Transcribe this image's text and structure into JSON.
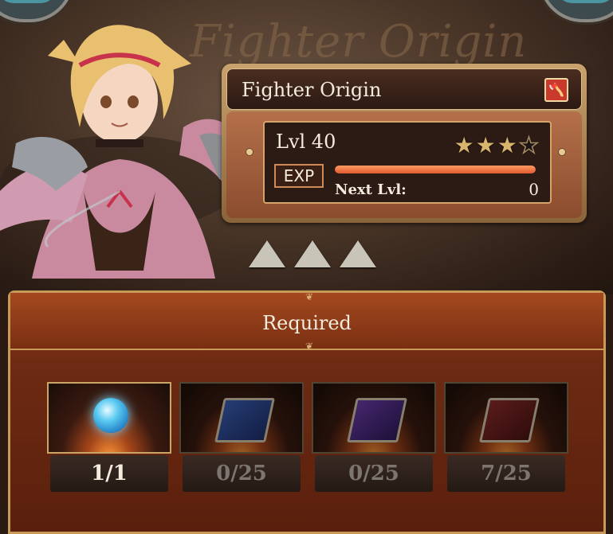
{
  "background_title": "Fighter Origin",
  "card": {
    "title": "Fighter Origin",
    "weapon_icon": "axe-icon",
    "level": "Lvl 40",
    "stars_filled": 3,
    "stars_total": 4,
    "exp_badge": "EXP",
    "exp_fill_percent": 100,
    "next_label": "Next Lvl:",
    "next_value": "0"
  },
  "limit_break_marks": 3,
  "panel": {
    "title": "Required",
    "items": [
      {
        "icon": "blue-orb-icon",
        "count": "1/1",
        "met": true
      },
      {
        "icon": "blue-book-icon",
        "count": "0/25",
        "met": false
      },
      {
        "icon": "purple-book-icon",
        "count": "0/25",
        "met": false
      },
      {
        "icon": "red-book-icon",
        "count": "7/25",
        "met": false
      }
    ]
  },
  "colors": {
    "accent_gold": "#c79a5a",
    "panel_red": "#8e3a1a",
    "exp_orange": "#e05a2e"
  }
}
